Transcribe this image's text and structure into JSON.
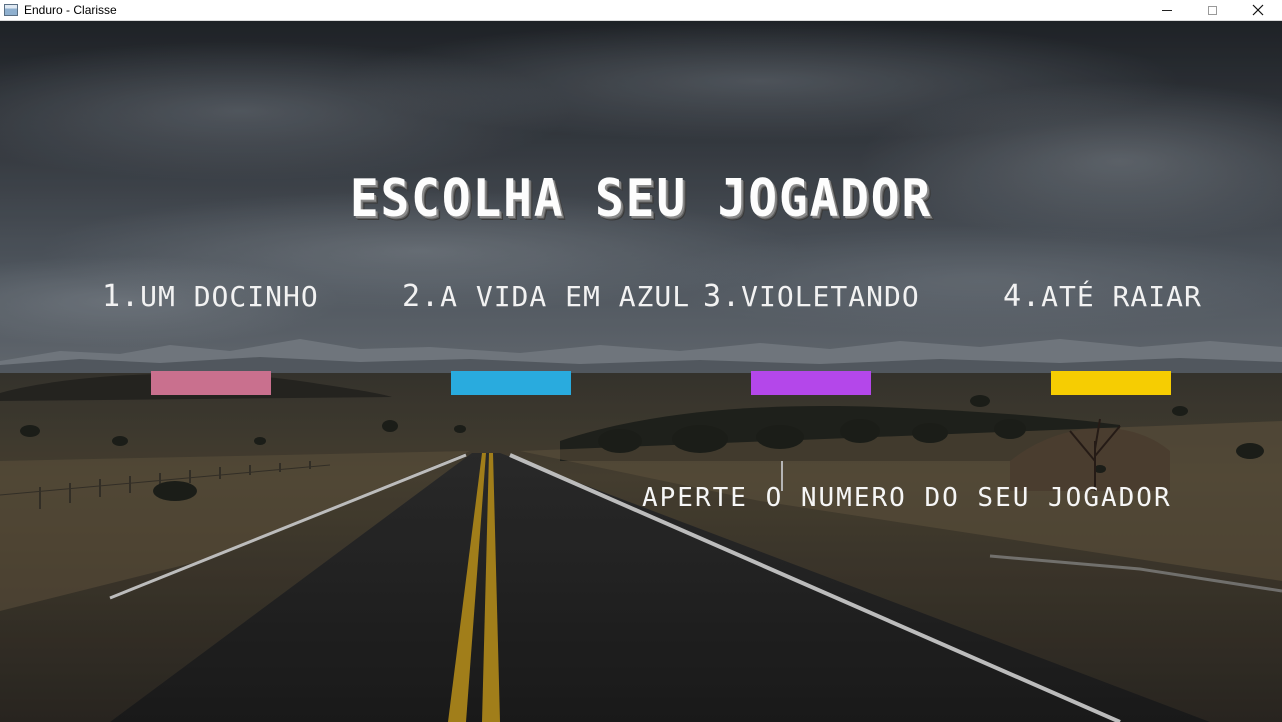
{
  "window": {
    "title": "Enduro - Clarisse",
    "controls": [
      "minimize",
      "maximize",
      "close"
    ]
  },
  "screen": {
    "headline": "Escolha seu jogador",
    "prompt": "Aperte o numero do seu jogador",
    "players": [
      {
        "label": "1.Um docinho",
        "color": "#c9708e"
      },
      {
        "label": "2.A vida em azul",
        "color": "#29abde"
      },
      {
        "label": "3.Violetando",
        "color": "#b447ea"
      },
      {
        "label": "4.Até raiar",
        "color": "#f6cd02"
      }
    ]
  },
  "background": {
    "description_colors": {
      "sky_top": "#2b2f35",
      "sky_mid": "#57606a",
      "mountains": "#8b929a",
      "grass": "#5a4f3d",
      "road": "#262626",
      "center_line": "#b08a1d",
      "edge_line": "#d9d9d9"
    }
  }
}
